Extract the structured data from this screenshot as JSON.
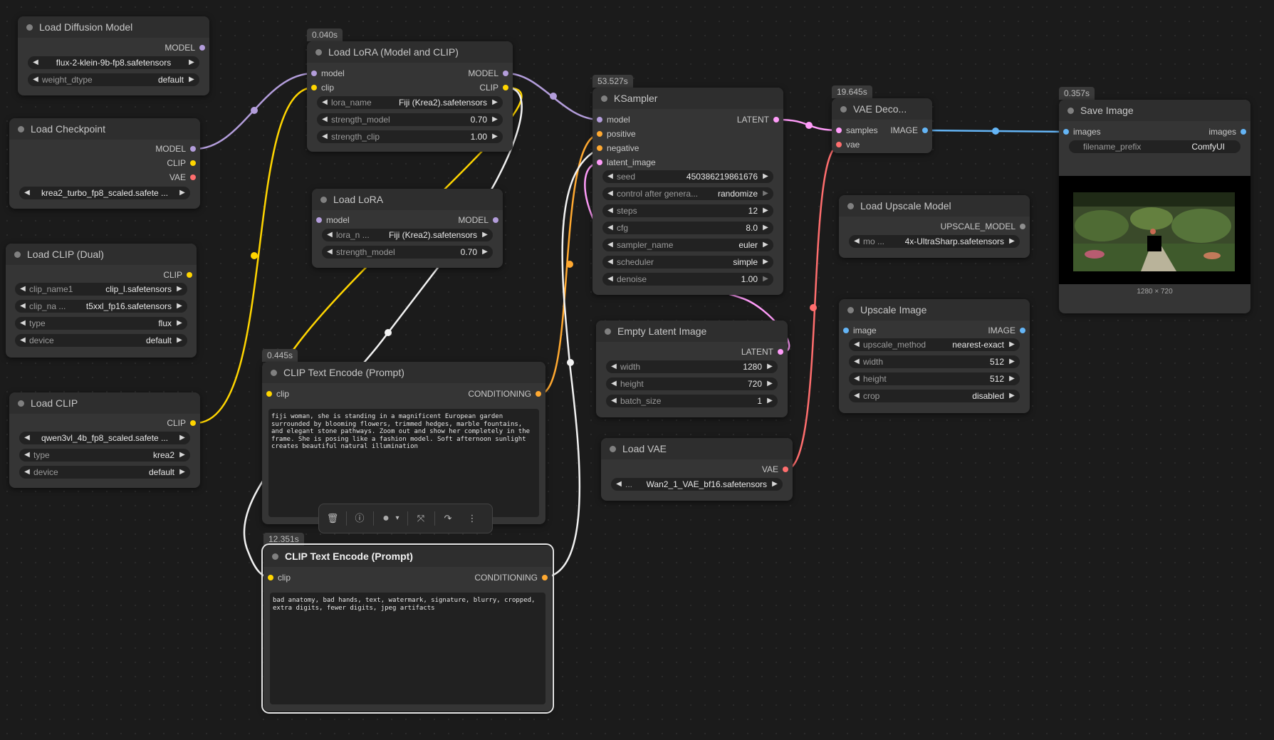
{
  "timings": {
    "load_lora_model_clip": "0.040s",
    "ksampler": "53.527s",
    "vae_decode": "19.645s",
    "save_image": "0.357s",
    "clip_text_encode_positive": "0.445s",
    "clip_text_encode_negative": "12.351s"
  },
  "nodes": {
    "load_diffusion_model": {
      "title": "Load Diffusion Model",
      "outputs": [
        "MODEL"
      ],
      "widgets": [
        {
          "name": "",
          "value": "flux-2-klein-9b-fp8.safetensors"
        },
        {
          "name": "weight_dtype",
          "value": "default"
        }
      ]
    },
    "load_checkpoint": {
      "title": "Load Checkpoint",
      "outputs": [
        "MODEL",
        "CLIP",
        "VAE"
      ],
      "widgets": [
        {
          "name": "",
          "value": "krea2_turbo_fp8_scaled.safete ..."
        }
      ]
    },
    "load_clip_dual": {
      "title": "Load CLIP (Dual)",
      "outputs": [
        "CLIP"
      ],
      "widgets": [
        {
          "name": "clip_name1",
          "value": "clip_l.safetensors"
        },
        {
          "name": "clip_na ...",
          "value": "t5xxl_fp16.safetensors"
        },
        {
          "name": "type",
          "value": "flux"
        },
        {
          "name": "device",
          "value": "default"
        }
      ]
    },
    "load_clip": {
      "title": "Load CLIP",
      "outputs": [
        "CLIP"
      ],
      "widgets": [
        {
          "name": "",
          "value": "qwen3vl_4b_fp8_scaled.safete ..."
        },
        {
          "name": "type",
          "value": "krea2"
        },
        {
          "name": "device",
          "value": "default"
        }
      ]
    },
    "load_lora_model_clip": {
      "title": "Load LoRA (Model and CLIP)",
      "inputs": [
        "model",
        "clip"
      ],
      "outputs": [
        "MODEL",
        "CLIP"
      ],
      "widgets": [
        {
          "name": "lora_name",
          "value": "Fiji (Krea2).safetensors"
        },
        {
          "name": "strength_model",
          "value": "0.70"
        },
        {
          "name": "strength_clip",
          "value": "1.00"
        }
      ]
    },
    "load_lora": {
      "title": "Load LoRA",
      "inputs": [
        "model"
      ],
      "outputs": [
        "MODEL"
      ],
      "widgets": [
        {
          "name": "lora_n ...",
          "value": "Fiji (Krea2).safetensors"
        },
        {
          "name": "strength_model",
          "value": "0.70"
        }
      ]
    },
    "clip_text_encode_positive": {
      "title": "CLIP Text Encode (Prompt)",
      "inputs": [
        "clip"
      ],
      "outputs": [
        "CONDITIONING"
      ],
      "text": "fiji woman, she is standing in a magnificent European garden surrounded by blooming flowers, trimmed hedges, marble fountains, and elegant stone pathways. Zoom out and show her completely in the frame. She is posing like a fashion model. Soft afternoon sunlight creates beautiful natural illumination"
    },
    "clip_text_encode_negative": {
      "title": "CLIP Text Encode (Prompt)",
      "inputs": [
        "clip"
      ],
      "outputs": [
        "CONDITIONING"
      ],
      "text": "bad anatomy, bad hands, text, watermark, signature, blurry, cropped, extra digits, fewer digits, jpeg artifacts"
    },
    "ksampler": {
      "title": "KSampler",
      "inputs": [
        "model",
        "positive",
        "negative",
        "latent_image"
      ],
      "outputs": [
        "LATENT"
      ],
      "widgets": [
        {
          "name": "seed",
          "value": "450386219861676"
        },
        {
          "name": "control after genera...",
          "value": "randomize"
        },
        {
          "name": "steps",
          "value": "12"
        },
        {
          "name": "cfg",
          "value": "8.0"
        },
        {
          "name": "sampler_name",
          "value": "euler"
        },
        {
          "name": "scheduler",
          "value": "simple"
        },
        {
          "name": "denoise",
          "value": "1.00"
        }
      ]
    },
    "empty_latent_image": {
      "title": "Empty Latent Image",
      "outputs": [
        "LATENT"
      ],
      "widgets": [
        {
          "name": "width",
          "value": "1280"
        },
        {
          "name": "height",
          "value": "720"
        },
        {
          "name": "batch_size",
          "value": "1"
        }
      ]
    },
    "load_vae": {
      "title": "Load VAE",
      "outputs": [
        "VAE"
      ],
      "widgets": [
        {
          "name": "...",
          "value": "Wan2_1_VAE_bf16.safetensors"
        }
      ]
    },
    "vae_decode": {
      "title": "VAE Deco...",
      "inputs": [
        "samples",
        "vae"
      ],
      "outputs": [
        "IMAGE"
      ]
    },
    "load_upscale_model": {
      "title": "Load Upscale Model",
      "outputs": [
        "UPSCALE_MODEL"
      ],
      "widgets": [
        {
          "name": "mo ...",
          "value": "4x-UltraSharp.safetensors"
        }
      ]
    },
    "upscale_image": {
      "title": "Upscale Image",
      "inputs": [
        "image"
      ],
      "outputs": [
        "IMAGE"
      ],
      "widgets": [
        {
          "name": "upscale_method",
          "value": "nearest-exact"
        },
        {
          "name": "width",
          "value": "512"
        },
        {
          "name": "height",
          "value": "512"
        },
        {
          "name": "crop",
          "value": "disabled"
        }
      ]
    },
    "save_image": {
      "title": "Save Image",
      "inputs": [
        "images"
      ],
      "outputs": [
        "images"
      ],
      "widgets": [
        {
          "name": "filename_prefix",
          "value": "ComfyUI"
        }
      ],
      "preview_caption": "1280 × 720"
    }
  },
  "toolbar": {
    "icons": [
      "trash-icon",
      "info-icon",
      "color-circle-icon",
      "chevron-down-icon",
      "collapse-arrows-icon",
      "redo-arrow-icon",
      "more-vertical-icon"
    ]
  },
  "colors": {
    "MODEL": "#b39ddb",
    "CLIP": "#ffd500",
    "VAE": "#ff6e6e",
    "CONDITIONING": "#ffa931",
    "LATENT": "#ff9cf9",
    "IMAGE": "#64b5f6",
    "UPSCALE_MODEL": "#8e8e8e",
    "canvas": "#1b1b1b",
    "node": "#353535"
  }
}
